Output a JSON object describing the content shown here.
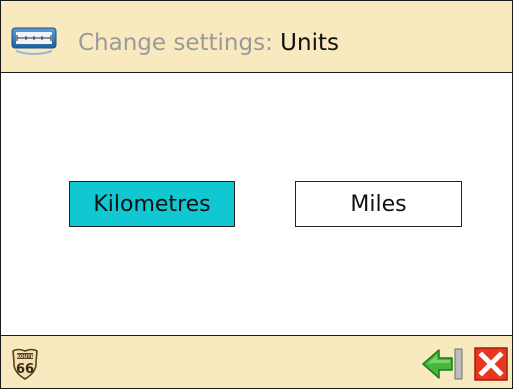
{
  "header": {
    "prefix": "Change settings: ",
    "value": "Units",
    "icon": "ruler-icon"
  },
  "options": [
    {
      "label": "Kilometres",
      "selected": true
    },
    {
      "label": "Miles",
      "selected": false
    }
  ],
  "footer": {
    "logo_icon": "route-66-icon",
    "logo_text_top": "ROUTE",
    "logo_text_number": "66",
    "back_icon": "back-arrow-icon",
    "close_icon": "close-icon"
  },
  "colors": {
    "bar_background": "#f8e9bf",
    "selected_option": "#11c8d2",
    "close_red": "#e8361f",
    "back_green": "#43b83a"
  }
}
